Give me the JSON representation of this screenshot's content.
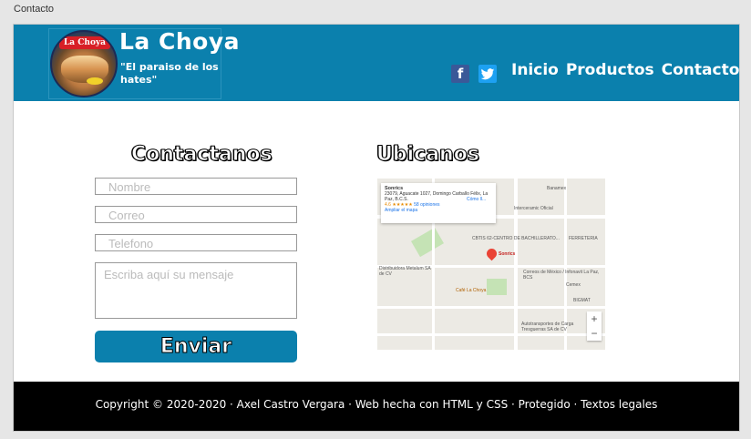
{
  "window": {
    "tab_title": "Contacto"
  },
  "header": {
    "logo_banner": "La Choya",
    "brand_name": "La Choya",
    "slogan": "\"El paraiso de los hates\"",
    "social": {
      "facebook_icon": "f",
      "twitter_icon": "t"
    },
    "nav": [
      "Inicio",
      "Productos",
      "Contacto"
    ],
    "color": "#0b80ad"
  },
  "contact": {
    "title": "Contactanos",
    "fields": {
      "name_placeholder": "Nombre",
      "email_placeholder": "Correo",
      "phone_placeholder": "Telefono",
      "message_placeholder": "Escriba aquí su mensaje"
    },
    "submit_label": "Enviar"
  },
  "map": {
    "title": "Ubicanos",
    "card": {
      "name": "Sonrics",
      "address": "23079, Aguacate 1027, Domingo Carballo Félix, La Paz, B.C.S.",
      "rating": "4.6 ★★★★★",
      "reviews": "58 opiniones",
      "link": "Ampliar el mapa",
      "directions": "Cómo ll..."
    },
    "labels": {
      "pin": "Sonrics",
      "cbtis": "CBTIS 62-CENTRO DE BACHILLERATO...",
      "distributor": "Distribuidora Metalum SA de CV",
      "cafe": "Café La Choya",
      "cemex": "Cemex",
      "bigmat": "BIGMAT",
      "ferreteria": "FERRETERIA",
      "correos": "Correos de México / Infonavit La Paz, BCS",
      "autotransportes": "Autotransportes de Carga Tresguerras SA de CV",
      "interceramic": "Interceramic Oficial",
      "banamex": "Banamex"
    },
    "zoom_in": "+",
    "zoom_out": "−"
  },
  "footer": {
    "text": "Copyright ©  2020-2020 · Axel Castro Vergara · Web hecha con HTML y CSS · Protegido · Textos legales"
  }
}
